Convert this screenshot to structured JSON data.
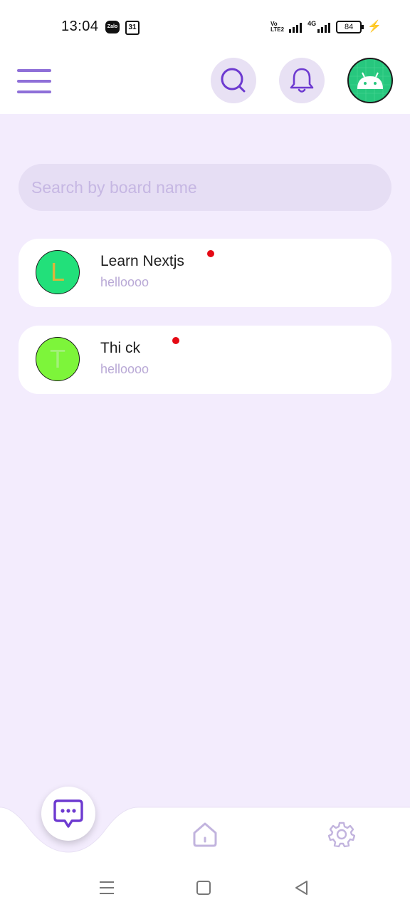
{
  "status_bar": {
    "time": "13:04",
    "zalo_label": "Zalo",
    "calendar_day": "31",
    "volte_label": "Vo LTE2",
    "network_label": "4G",
    "battery": "84"
  },
  "header": {
    "menu_icon": "hamburger-menu-icon",
    "search_icon": "search-icon",
    "notifications_icon": "bell-icon",
    "profile_icon": "android-avatar-icon"
  },
  "search": {
    "placeholder": "Search by board name",
    "value": ""
  },
  "boards": [
    {
      "initial": "L",
      "title": "Learn Nextjs",
      "subtitle": "helloooo",
      "avatar_color": "#22e07a",
      "initial_color": "#e0b43a",
      "unread": true
    },
    {
      "initial": "T",
      "title": "Thi ck",
      "subtitle": "helloooo",
      "avatar_color": "#7df53a",
      "initial_color": "#a3f07a",
      "unread": true
    }
  ],
  "bottom_nav": {
    "items": [
      {
        "icon": "chat-bubble-icon",
        "active": true
      },
      {
        "icon": "home-icon",
        "active": false
      },
      {
        "icon": "settings-gear-icon",
        "active": false
      }
    ]
  },
  "colors": {
    "accent": "#6d3ad0",
    "accent_light": "#8e6fd8",
    "background": "#f3ecfd",
    "unread_dot": "#e50914"
  }
}
